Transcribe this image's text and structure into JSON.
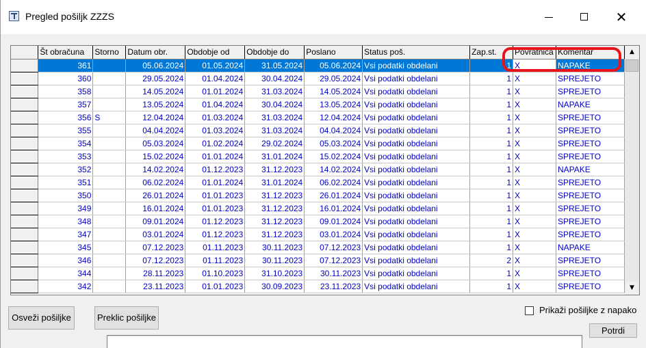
{
  "window": {
    "title": "Pregled pošiljk ZZZS",
    "minimize_glyph": "—",
    "close_glyph": "✕"
  },
  "grid": {
    "columns": [
      "Št obračuna",
      "Storno",
      "Datum obr.",
      "Obdobje od",
      "Obdobje do",
      "Poslano",
      "Status poš.",
      "Zap.st.",
      "Povratnica",
      "Komentar"
    ],
    "rows": [
      {
        "st": "361",
        "storno": "",
        "datum": "05.06.2024",
        "od": "01.05.2024",
        "do": "31.05.2024",
        "poslano": "05.06.2024",
        "status": "Vsi podatki obdelani",
        "zap": "1",
        "povratnica": "X",
        "komentar": "NAPAKE"
      },
      {
        "st": "360",
        "storno": "",
        "datum": "29.05.2024",
        "od": "01.04.2024",
        "do": "30.04.2024",
        "poslano": "29.05.2024",
        "status": "Vsi podatki obdelani",
        "zap": "1",
        "povratnica": "X",
        "komentar": "SPREJETO"
      },
      {
        "st": "358",
        "storno": "",
        "datum": "14.05.2024",
        "od": "01.01.2024",
        "do": "31.03.2024",
        "poslano": "14.05.2024",
        "status": "Vsi podatki obdelani",
        "zap": "1",
        "povratnica": "X",
        "komentar": "SPREJETO"
      },
      {
        "st": "357",
        "storno": "",
        "datum": "13.05.2024",
        "od": "01.04.2024",
        "do": "30.04.2024",
        "poslano": "13.05.2024",
        "status": "Vsi podatki obdelani",
        "zap": "1",
        "povratnica": "X",
        "komentar": "NAPAKE"
      },
      {
        "st": "356",
        "storno": "S",
        "datum": "12.04.2024",
        "od": "01.03.2024",
        "do": "31.03.2024",
        "poslano": "12.04.2024",
        "status": "Vsi podatki obdelani",
        "zap": "1",
        "povratnica": "X",
        "komentar": "SPREJETO"
      },
      {
        "st": "355",
        "storno": "",
        "datum": "04.04.2024",
        "od": "01.03.2024",
        "do": "31.03.2024",
        "poslano": "04.04.2024",
        "status": "Vsi podatki obdelani",
        "zap": "1",
        "povratnica": "X",
        "komentar": "SPREJETO"
      },
      {
        "st": "354",
        "storno": "",
        "datum": "05.03.2024",
        "od": "01.02.2024",
        "do": "29.02.2024",
        "poslano": "05.03.2024",
        "status": "Vsi podatki obdelani",
        "zap": "1",
        "povratnica": "X",
        "komentar": "SPREJETO"
      },
      {
        "st": "353",
        "storno": "",
        "datum": "15.02.2024",
        "od": "01.01.2024",
        "do": "31.01.2024",
        "poslano": "15.02.2024",
        "status": "Vsi podatki obdelani",
        "zap": "1",
        "povratnica": "X",
        "komentar": "SPREJETO"
      },
      {
        "st": "352",
        "storno": "",
        "datum": "14.02.2024",
        "od": "01.12.2023",
        "do": "31.12.2023",
        "poslano": "14.02.2024",
        "status": "Vsi podatki obdelani",
        "zap": "1",
        "povratnica": "X",
        "komentar": "NAPAKE"
      },
      {
        "st": "351",
        "storno": "",
        "datum": "06.02.2024",
        "od": "01.01.2024",
        "do": "31.01.2024",
        "poslano": "06.02.2024",
        "status": "Vsi podatki obdelani",
        "zap": "1",
        "povratnica": "X",
        "komentar": "SPREJETO"
      },
      {
        "st": "350",
        "storno": "",
        "datum": "26.01.2024",
        "od": "01.01.2023",
        "do": "31.12.2023",
        "poslano": "26.01.2024",
        "status": "Vsi podatki obdelani",
        "zap": "1",
        "povratnica": "X",
        "komentar": "SPREJETO"
      },
      {
        "st": "349",
        "storno": "",
        "datum": "16.01.2024",
        "od": "01.01.2023",
        "do": "31.12.2023",
        "poslano": "16.01.2024",
        "status": "Vsi podatki obdelani",
        "zap": "1",
        "povratnica": "X",
        "komentar": "SPREJETO"
      },
      {
        "st": "348",
        "storno": "",
        "datum": "09.01.2024",
        "od": "01.12.2023",
        "do": "31.12.2023",
        "poslano": "09.01.2024",
        "status": "Vsi podatki obdelani",
        "zap": "1",
        "povratnica": "X",
        "komentar": "SPREJETO"
      },
      {
        "st": "347",
        "storno": "",
        "datum": "03.01.2024",
        "od": "01.12.2023",
        "do": "31.12.2023",
        "poslano": "03.01.2024",
        "status": "Vsi podatki obdelani",
        "zap": "1",
        "povratnica": "X",
        "komentar": "SPREJETO"
      },
      {
        "st": "345",
        "storno": "",
        "datum": "07.12.2023",
        "od": "01.11.2023",
        "do": "30.11.2023",
        "poslano": "07.12.2023",
        "status": "Vsi podatki obdelani",
        "zap": "1",
        "povratnica": "X",
        "komentar": "NAPAKE"
      },
      {
        "st": "346",
        "storno": "",
        "datum": "07.12.2023",
        "od": "01.11.2023",
        "do": "30.11.2023",
        "poslano": "07.12.2023",
        "status": "Vsi podatki obdelani",
        "zap": "2",
        "povratnica": "X",
        "komentar": "SPREJETO"
      },
      {
        "st": "344",
        "storno": "",
        "datum": "28.11.2023",
        "od": "01.10.2023",
        "do": "31.10.2023",
        "poslano": "30.11.2023",
        "status": "Vsi podatki obdelani",
        "zap": "1",
        "povratnica": "X",
        "komentar": "SPREJETO"
      },
      {
        "st": "342",
        "storno": "",
        "datum": "23.11.2023",
        "od": "01.01.2023",
        "do": "30.09.2023",
        "poslano": "23.11.2023",
        "status": "Vsi podatki obdelani",
        "zap": "1",
        "povratnica": "X",
        "komentar": "SPREJETO"
      }
    ],
    "selected_row": 0
  },
  "buttons": {
    "refresh": "Osveži pošiljke",
    "cancel_shipment": "Preklic pošiljke",
    "confirm": "Potrdi"
  },
  "filter": {
    "show_errors_label": "Prikaži pošiljke z napako",
    "checked": false
  },
  "scrollbar": {
    "up_glyph": "▲",
    "down_glyph": "▼"
  },
  "colors": {
    "selection": "#0078d7",
    "cell_text": "#0000c8",
    "highlight": "#e8141c"
  }
}
